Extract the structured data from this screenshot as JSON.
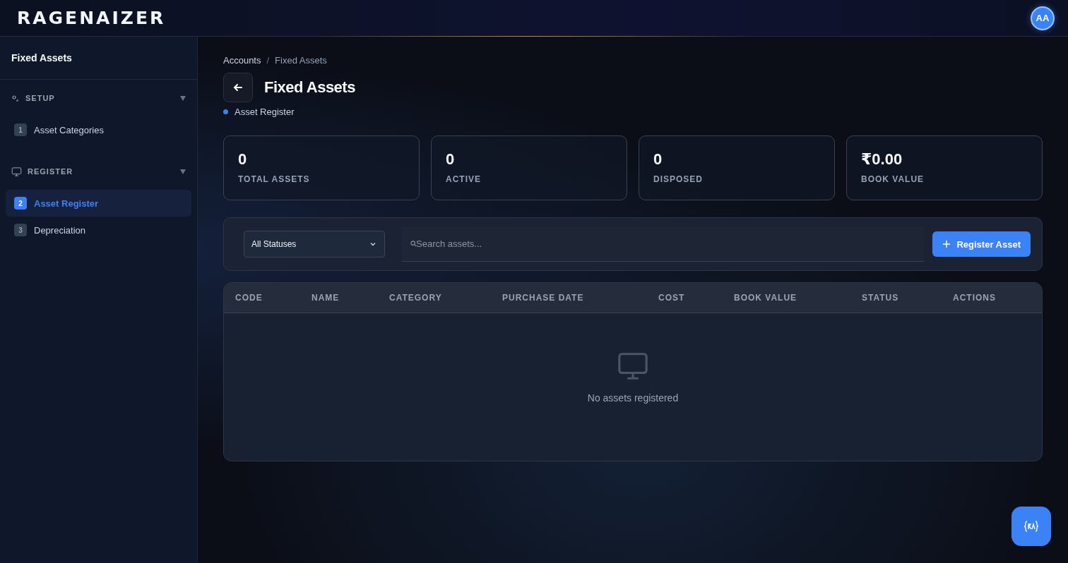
{
  "header": {
    "logo": "RAGENAIZER",
    "avatar": "AA"
  },
  "sidebar": {
    "title": "Fixed Assets",
    "sections": [
      {
        "label": "SETUP",
        "kind": "setup",
        "expanded": true,
        "items": [
          {
            "number": "1",
            "label": "Asset Categories",
            "selected": false
          }
        ]
      },
      {
        "label": "REGISTER",
        "kind": "monitor",
        "expanded": true,
        "items": [
          {
            "number": "2",
            "label": "Asset Register",
            "selected": true
          },
          {
            "number": "3",
            "label": "Depreciation",
            "selected": false
          }
        ]
      }
    ]
  },
  "breadcrumb": {
    "items": [
      "Accounts",
      "Fixed Assets"
    ],
    "separator": "/"
  },
  "page": {
    "title": "Fixed Assets",
    "subtitle": "Asset Register"
  },
  "stats": [
    {
      "value": "0",
      "label": "TOTAL ASSETS"
    },
    {
      "value": "0",
      "label": "ACTIVE"
    },
    {
      "value": "0",
      "label": "DISPOSED"
    },
    {
      "value": "₹0.00",
      "label": "BOOK VALUE"
    }
  ],
  "filters": {
    "status": "All Statuses",
    "search_placeholder": "Search assets...",
    "button": "Register Asset"
  },
  "table": {
    "columns": [
      "CODE",
      "NAME",
      "CATEGORY",
      "PURCHASE DATE",
      "COST",
      "BOOK VALUE",
      "STATUS",
      "ACTIONS"
    ],
    "empty_message": "No assets registered"
  }
}
